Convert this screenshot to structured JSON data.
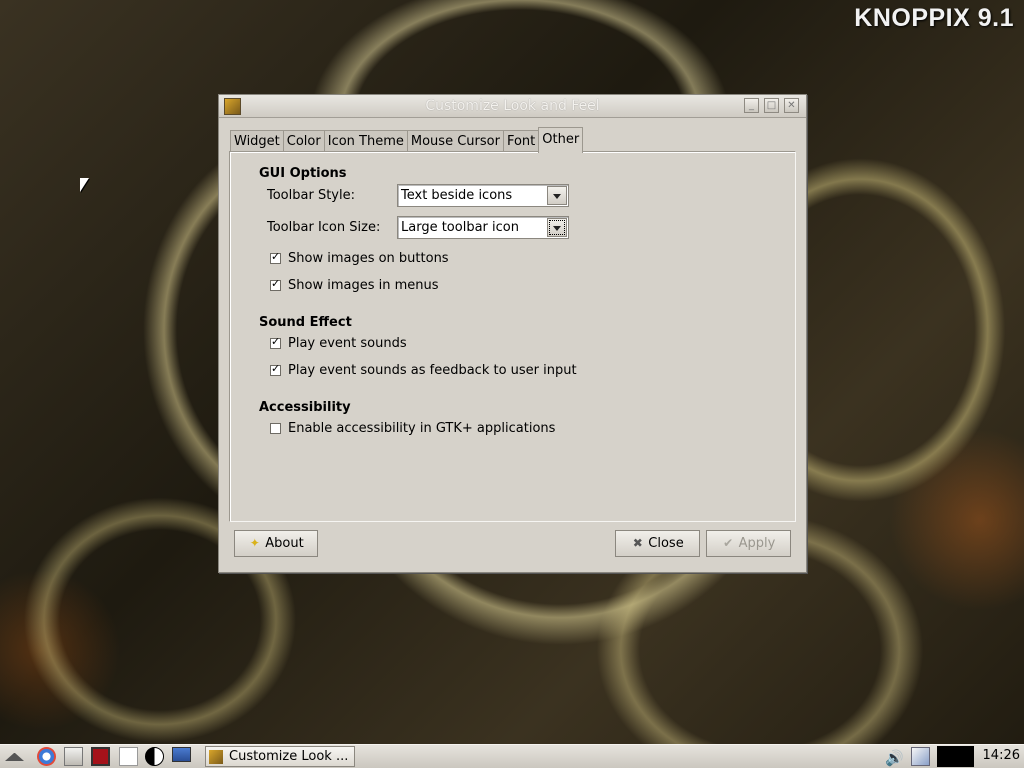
{
  "desktop": {
    "brand_title": "KNOPPIX 9.1"
  },
  "window": {
    "title": "Customize Look and Feel",
    "tabs": [
      "Widget",
      "Color",
      "Icon Theme",
      "Mouse Cursor",
      "Font",
      "Other"
    ],
    "active_tab": "Other"
  },
  "gui_options": {
    "heading": "GUI Options",
    "toolbar_style_label": "Toolbar Style:",
    "toolbar_style_value": "Text beside icons",
    "toolbar_icon_size_label": "Toolbar Icon Size:",
    "toolbar_icon_size_value": "Large toolbar icon",
    "show_images_buttons": {
      "label": "Show images on buttons",
      "checked": true
    },
    "show_images_menus": {
      "label": "Show images in menus",
      "checked": true
    }
  },
  "sound_effect": {
    "heading": "Sound Effect",
    "play_event_sounds": {
      "label": "Play event sounds",
      "checked": true
    },
    "play_feedback_sounds": {
      "label": "Play event sounds as feedback to user input",
      "checked": true
    }
  },
  "accessibility": {
    "heading": "Accessibility",
    "enable_gtk": {
      "label": "Enable accessibility in GTK+ applications",
      "checked": false
    }
  },
  "buttons": {
    "about": "About",
    "close": "Close",
    "apply": "Apply"
  },
  "taskbar": {
    "task_label": "Customize Look ...",
    "clock": "14:26",
    "icons": [
      "menu-icon",
      "chromium-icon",
      "file-manager-icon",
      "terminal-icon",
      "document-icon",
      "mixer-icon",
      "monitor-icon",
      "volume-icon",
      "network-icon"
    ]
  }
}
